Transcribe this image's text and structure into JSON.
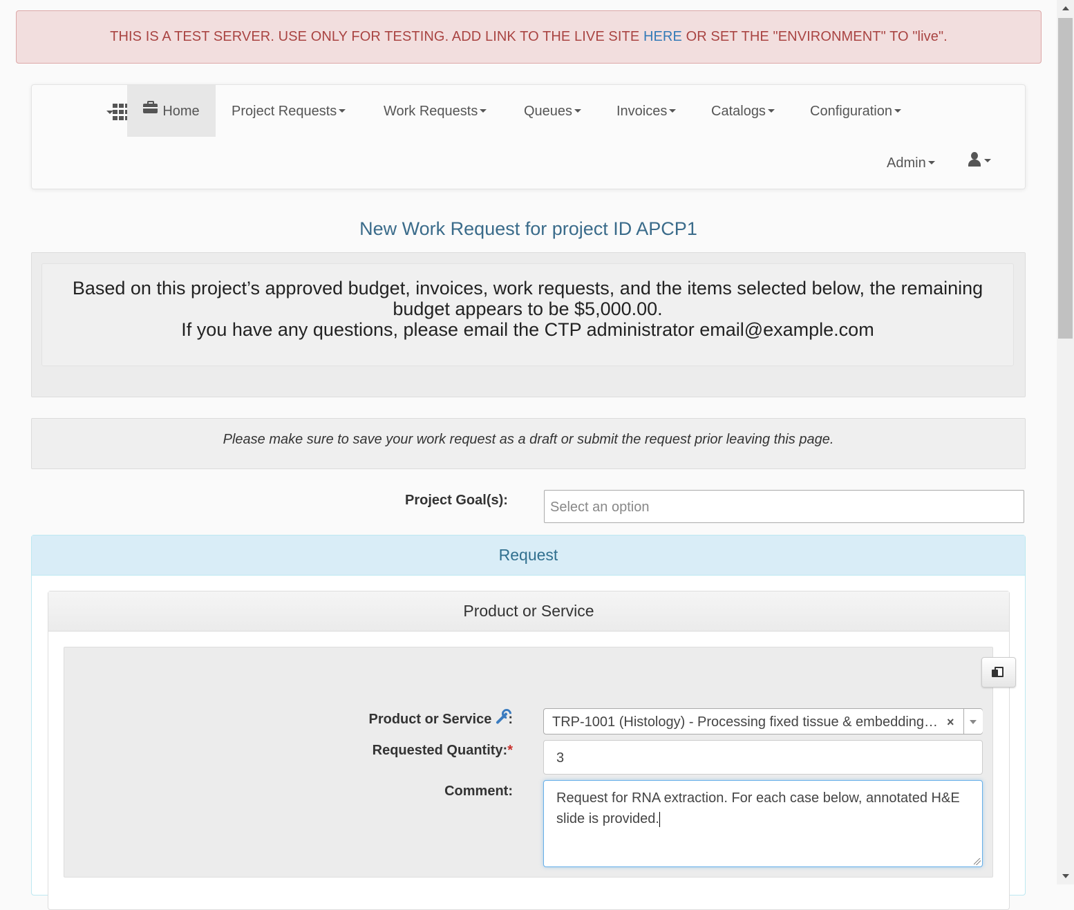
{
  "alert": {
    "text_before": "THIS IS A TEST SERVER. USE ONLY FOR TESTING.  ADD LINK TO THE LIVE SITE ",
    "link_label": "HERE",
    "text_after": " OR SET THE \"ENVIRONMENT\" TO \"live\"."
  },
  "nav": {
    "apps_icon": "grid-icon",
    "home_icon": "briefcase-icon",
    "home": "Home",
    "items": [
      "Project Requests",
      "Work Requests",
      "Queues",
      "Invoices",
      "Catalogs",
      "Configuration"
    ],
    "admin": "Admin",
    "user_icon": "user-icon"
  },
  "page_title": "New Work Request for project ID APCP1",
  "budget": {
    "line1": "Based on this project’s approved budget, invoices, work requests, and the items selected below, the remaining",
    "line2": "budget appears to be $5,000.00.",
    "line3": "If you have any questions, please email the CTP administrator email@example.com"
  },
  "notice": "Please make sure to save your work request as a draft or submit the request prior leaving this page.",
  "project_goals": {
    "label": "Project Goal(s):",
    "placeholder": "Select an option"
  },
  "request_panel": {
    "heading": "Request",
    "product_panel": {
      "heading": "Product or Service",
      "copy_icon": "copy-icon",
      "product_label": "Product or Service",
      "product_label_suffix": ":",
      "wrench_icon": "wrench-icon",
      "product_value": "TRP-1001 (Histology) - Processing fixed tissue & embedding in paraffin",
      "clear_symbol": "×",
      "quantity_label": "Requested Quantity:",
      "required_mark": "*",
      "quantity_value": "3",
      "comment_label": "Comment:",
      "comment_value": "Request for RNA extraction. For each case below, annotated H&E slide is provided."
    }
  },
  "colors": {
    "alert_bg": "#f2dede",
    "alert_text": "#a94442",
    "link": "#337ab7",
    "title": "#3a6b8a",
    "panel_heading_bg": "#d9edf7",
    "panel_heading_text": "#31708f"
  }
}
